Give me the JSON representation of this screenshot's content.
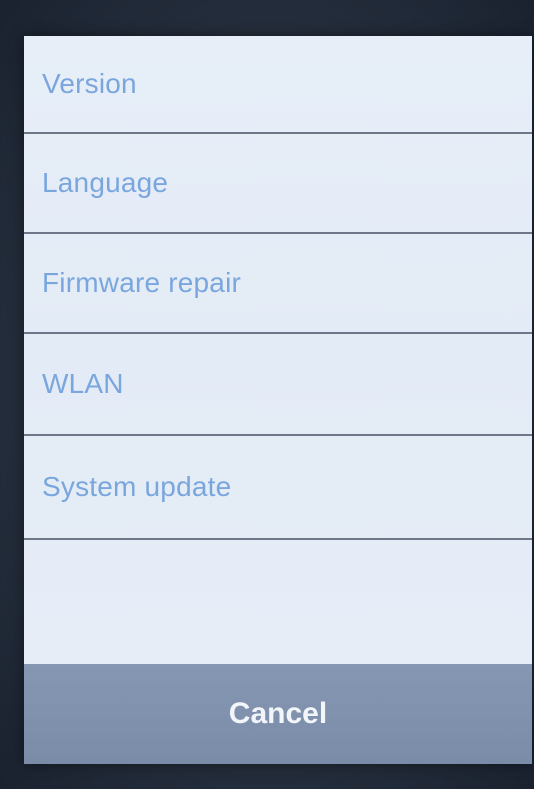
{
  "menu": {
    "items": [
      {
        "label": "Version"
      },
      {
        "label": "Language"
      },
      {
        "label": "Firmware repair"
      },
      {
        "label": "WLAN"
      },
      {
        "label": "System update"
      }
    ]
  },
  "actions": {
    "cancel_label": "Cancel"
  },
  "colors": {
    "item_text": "#7aa6de",
    "background": "#e3ebf6",
    "cancel_bar": "#7f91ad",
    "divider": "#6d7787"
  }
}
